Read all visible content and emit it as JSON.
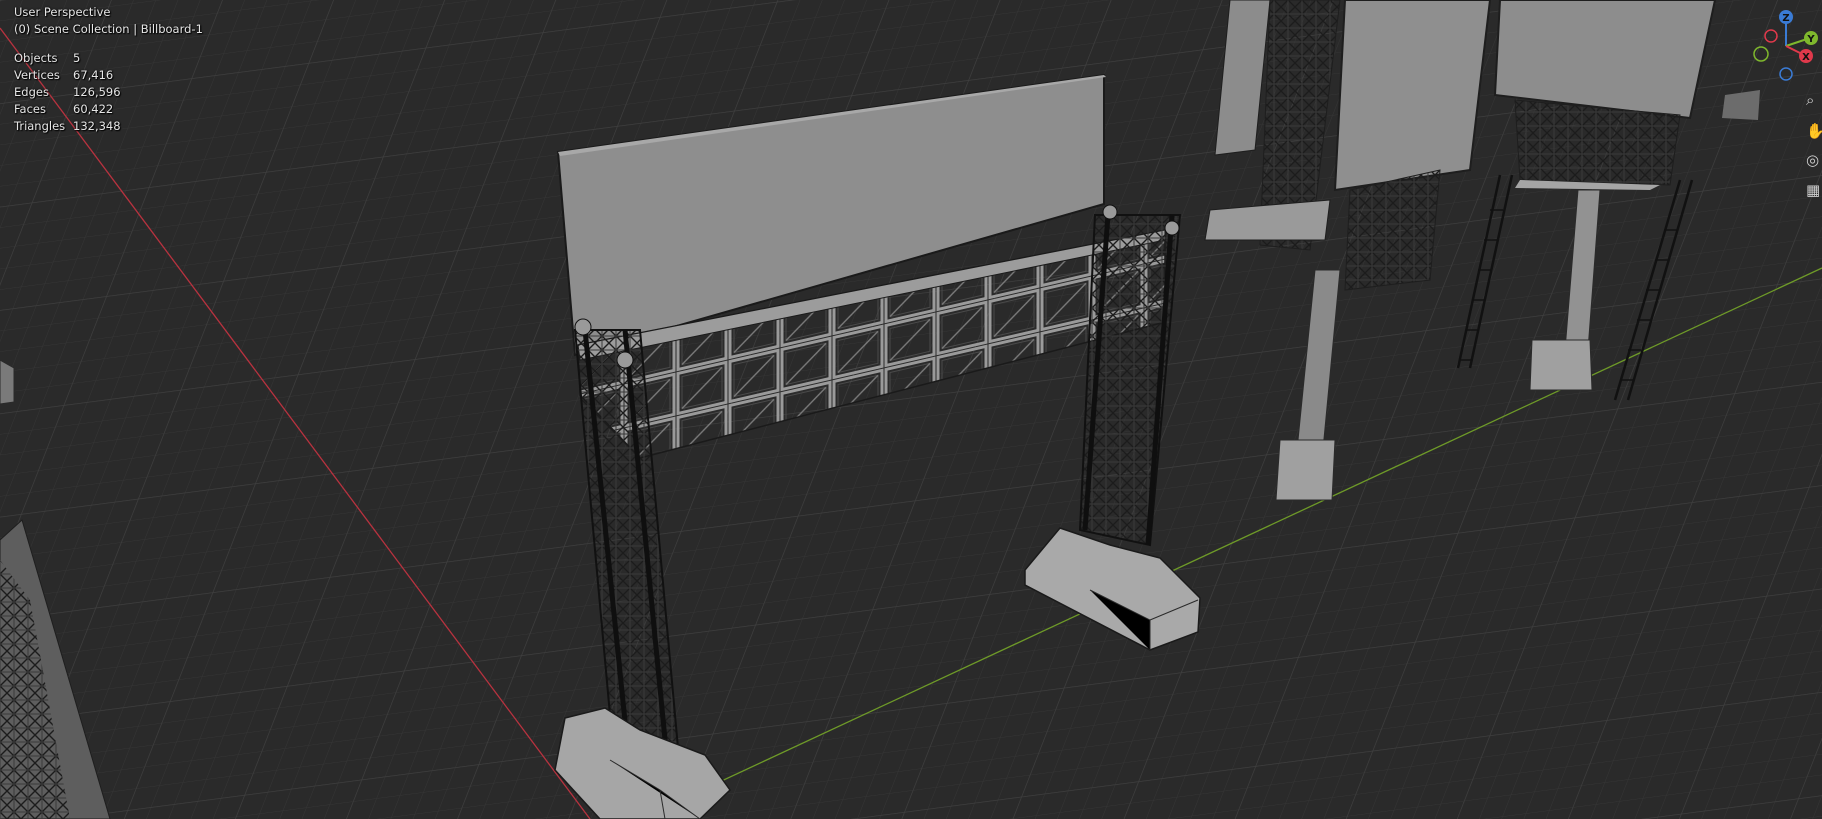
{
  "viewport": {
    "view_title": "User Perspective",
    "scene_path": "(0) Scene Collection | Billboard-1",
    "stats": [
      {
        "label": "Objects",
        "value": "5"
      },
      {
        "label": "Vertices",
        "value": "67,416"
      },
      {
        "label": "Edges",
        "value": "126,596"
      },
      {
        "label": "Faces",
        "value": "60,422"
      },
      {
        "label": "Triangles",
        "value": "132,348"
      }
    ]
  },
  "gizmo": {
    "z_label": "Z",
    "y_label": "Y",
    "x_label": "X",
    "colors": {
      "z": "#3a7bd5",
      "y": "#7fb82d",
      "x": "#e0394b"
    }
  },
  "nav_tools": [
    {
      "icon": "zoom-icon",
      "glyph": "⌕"
    },
    {
      "icon": "pan-hand-icon",
      "glyph": "✋"
    },
    {
      "icon": "camera-view-icon",
      "glyph": "◎"
    },
    {
      "icon": "ortho-grid-icon",
      "glyph": "▦"
    }
  ],
  "colors": {
    "background": "#2a2a2a",
    "grid": "#3a3a3a",
    "x_axis": "#b8323f",
    "y_axis": "#6e9a28",
    "model": "#8a8a8a"
  }
}
